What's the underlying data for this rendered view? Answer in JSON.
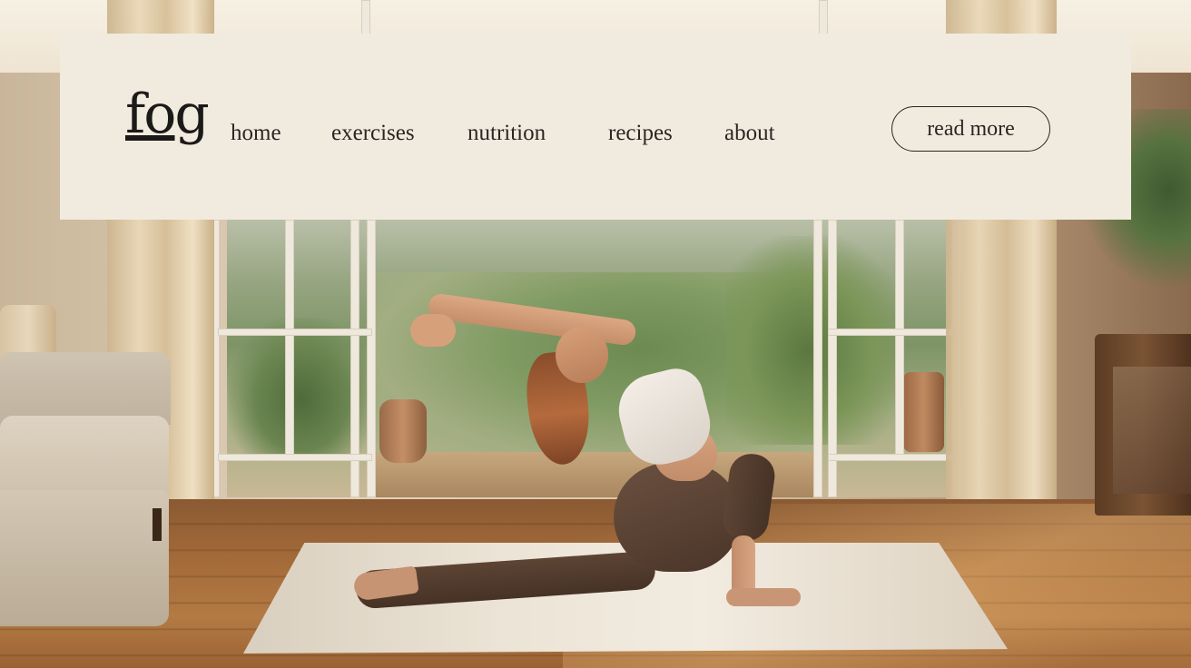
{
  "brand": {
    "logo_text": "fog"
  },
  "nav": {
    "links": [
      {
        "label": "home"
      },
      {
        "label": "exercises"
      },
      {
        "label": "nutrition"
      },
      {
        "label": "recipes"
      },
      {
        "label": "about"
      }
    ]
  },
  "cta": {
    "label": "read more"
  },
  "colors": {
    "panel_background": "#f1ebdf",
    "text": "#2a2623",
    "logo": "#1c1a18"
  },
  "hero_image": {
    "subject": "woman doing a yoga stretch on a rug in a sunlit living room"
  }
}
